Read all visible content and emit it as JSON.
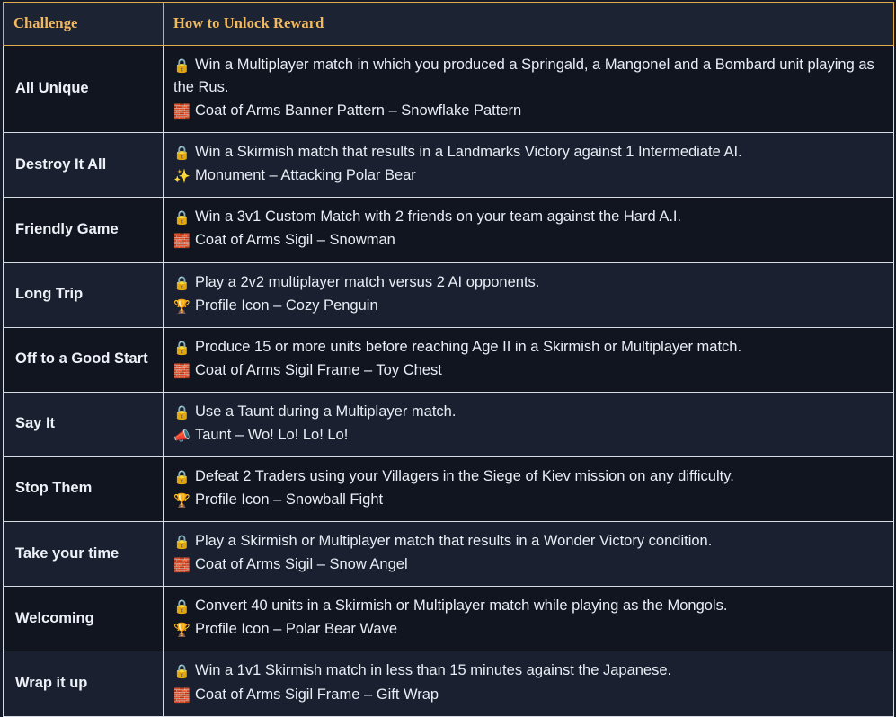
{
  "table": {
    "headers": {
      "challenge": "Challenge",
      "how_to_unlock": "How to Unlock Reward"
    },
    "colors": {
      "header_text": "#f2b95e",
      "header_border": "#e2ab4e",
      "cell_border": "#d7dbe2",
      "page_background": "#151b28",
      "row_dark": "#10151f",
      "row_light": "#1a2030",
      "body_text": "#e9edf4"
    },
    "rows": [
      {
        "challenge": "All Unique",
        "requirement_icon": "lock-icon",
        "requirement": "Win a Multiplayer match in which you produced a Springald, a Mangonel and a Bombard unit playing as the Rus.",
        "reward_icon": "bricks-icon",
        "reward": "Coat of Arms Banner Pattern – Snowflake Pattern"
      },
      {
        "challenge": "Destroy It All",
        "requirement_icon": "lock-icon",
        "requirement": "Win a Skirmish match that results in a Landmarks Victory against 1 Intermediate AI.",
        "reward_icon": "sparkles-icon",
        "reward": "Monument – Attacking Polar Bear"
      },
      {
        "challenge": "Friendly Game",
        "requirement_icon": "lock-icon",
        "requirement": "Win a 3v1 Custom Match with 2 friends on your team against the Hard A.I.",
        "reward_icon": "bricks-icon",
        "reward": "Coat of Arms Sigil – Snowman"
      },
      {
        "challenge": "Long Trip",
        "requirement_icon": "lock-icon",
        "requirement": "Play a 2v2 multiplayer match versus 2 AI opponents.",
        "reward_icon": "trophy-icon",
        "reward": "Profile Icon – Cozy Penguin"
      },
      {
        "challenge": "Off to a Good Start",
        "requirement_icon": "lock-icon",
        "requirement": "Produce 15 or more units before reaching Age II in a Skirmish or Multiplayer match.",
        "reward_icon": "bricks-icon",
        "reward": "Coat of Arms Sigil Frame – Toy Chest"
      },
      {
        "challenge": "Say It",
        "requirement_icon": "lock-icon",
        "requirement": "Use a Taunt during a Multiplayer match.",
        "reward_icon": "megaphone-icon",
        "reward": "Taunt – Wo! Lo! Lo! Lo!"
      },
      {
        "challenge": "Stop Them",
        "requirement_icon": "lock-icon",
        "requirement": "Defeat 2 Traders using your Villagers in the Siege of Kiev mission on any difficulty.",
        "reward_icon": "trophy-icon",
        "reward": "Profile Icon – Snowball Fight"
      },
      {
        "challenge": "Take your time",
        "requirement_icon": "lock-icon",
        "requirement": "Play a Skirmish or Multiplayer match that results in a Wonder Victory condition.",
        "reward_icon": "bricks-icon",
        "reward": "Coat of Arms Sigil – Snow Angel"
      },
      {
        "challenge": "Welcoming",
        "requirement_icon": "lock-icon",
        "requirement": "Convert 40 units in a Skirmish or Multiplayer match while playing as the Mongols.",
        "reward_icon": "trophy-icon",
        "reward": "Profile Icon – Polar Bear Wave"
      },
      {
        "challenge": "Wrap it up",
        "requirement_icon": "lock-icon",
        "requirement": "Win a 1v1 Skirmish match in less than 15 minutes against the Japanese.",
        "reward_icon": "bricks-icon",
        "reward": "Coat of Arms Sigil Frame – Gift Wrap"
      }
    ]
  },
  "icon_glyphs": {
    "lock-icon": "🔒",
    "bricks-icon": "🧱",
    "sparkles-icon": "✨",
    "trophy-icon": "🏆",
    "megaphone-icon": "📣"
  }
}
